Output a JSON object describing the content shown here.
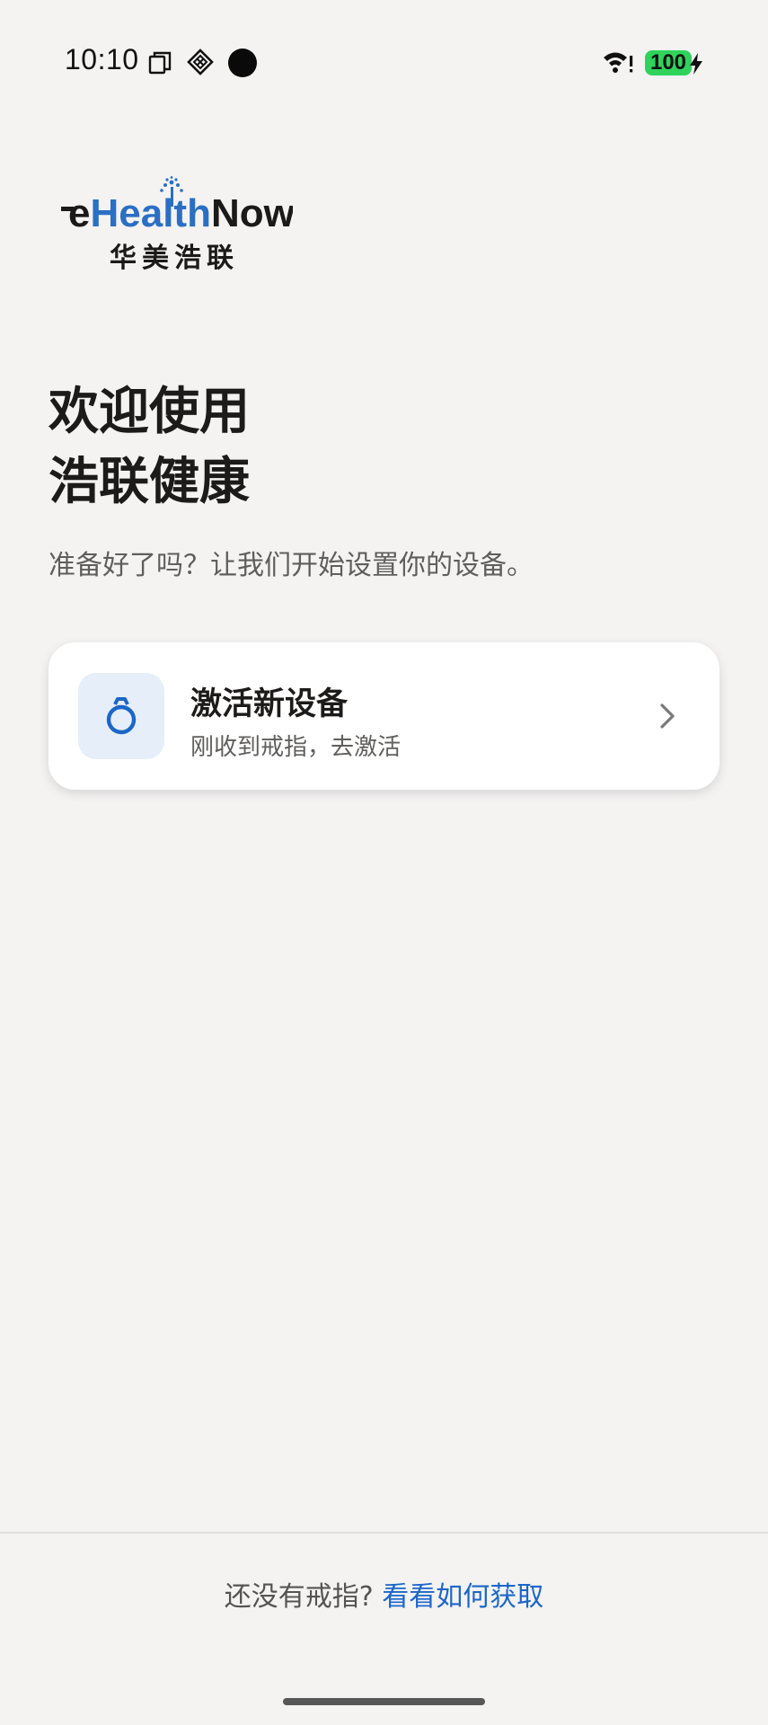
{
  "status_bar": {
    "time": "10:10",
    "battery_level": "100",
    "icons": [
      "copy-icon",
      "diamond-grid-icon",
      "dot-icon",
      "wifi-alert-icon",
      "battery-icon",
      "charging-bolt-icon"
    ],
    "battery_color": "#2fd35b"
  },
  "logo": {
    "brand_prefix": "e",
    "brand_health": "Health",
    "brand_now": "Now",
    "brand_cn": "华美浩联",
    "colors": {
      "blue": "#2a6fc4",
      "dark": "#1c1a19"
    }
  },
  "welcome": {
    "title": "欢迎使用\n浩联健康",
    "subtitle": "准备好了吗？让我们开始设置你的设备。"
  },
  "activate_card": {
    "icon": "ring-icon",
    "title": "激活新设备",
    "description": "刚收到戒指，去激活",
    "chevron": "chevron-right-icon"
  },
  "footer": {
    "question": "还没有戒指?",
    "link_label": "看看如何获取",
    "link_color": "#1b66c9"
  }
}
